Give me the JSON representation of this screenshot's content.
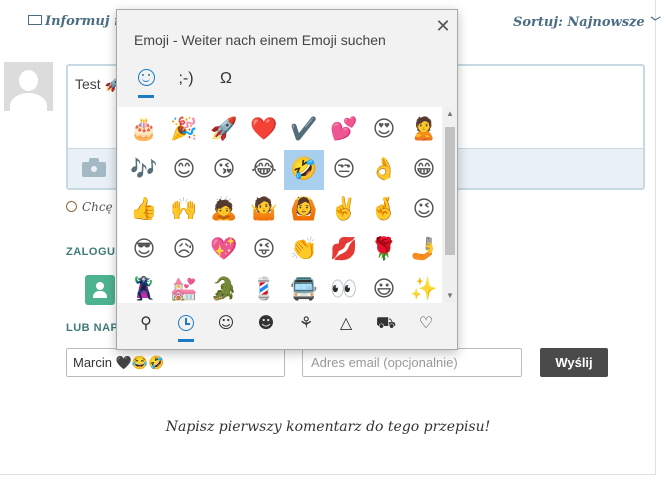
{
  "topbar": {
    "notify_label": "Informuj m",
    "sort_label": "Sortuj: Najnowsze"
  },
  "comment": {
    "text": "Test 🚀"
  },
  "notify_row": {
    "label": "Chcę s"
  },
  "sections": {
    "login_heading": "ZALOGUJ",
    "guest_heading": "LUB NAPI"
  },
  "form": {
    "name_value": "Marcin 🖤😂🤣",
    "email_placeholder": "Adres email (opcjonalnie)",
    "send_label": "Wyślij"
  },
  "footer": {
    "first_comment": "Napisz pierwszy komentarz do tego przepisu!"
  },
  "emoji_panel": {
    "title": "Emoji - Weiter nach einem Emoji suchen",
    "close_glyph": "✕",
    "tabs": [
      {
        "id": "emoji",
        "label": "",
        "active": true
      },
      {
        "id": "kaomoji",
        "label": ";-)",
        "active": false
      },
      {
        "id": "symbols",
        "label": "Ω",
        "active": false
      }
    ],
    "grid": [
      "🎂",
      "🎉",
      "🚀",
      "❤️",
      "✔️",
      "💕",
      "😍",
      "🙎",
      "🎶",
      "😊",
      "😘",
      "😂",
      "🤣",
      "😒",
      "👌",
      "😁",
      "👍",
      "🙌",
      "🙇",
      "🤷",
      "🙆",
      "✌️",
      "🤞",
      "😉",
      "😎",
      "😥",
      "💖",
      "😜",
      "👏",
      "💋",
      "🌹",
      "🤳",
      "🦹",
      "💒",
      "🐊",
      "💈",
      "🚍",
      "👀",
      "😃",
      "✨"
    ],
    "selected_index": 12,
    "categories": [
      {
        "id": "search",
        "glyph": "⚲"
      },
      {
        "id": "recent",
        "glyph": "",
        "active": true
      },
      {
        "id": "smileys",
        "glyph": "☺"
      },
      {
        "id": "people",
        "glyph": "☻"
      },
      {
        "id": "celebration",
        "glyph": "⚘"
      },
      {
        "id": "food",
        "glyph": "△"
      },
      {
        "id": "transport",
        "glyph": "⛟"
      },
      {
        "id": "symbols",
        "glyph": "♡"
      }
    ]
  }
}
